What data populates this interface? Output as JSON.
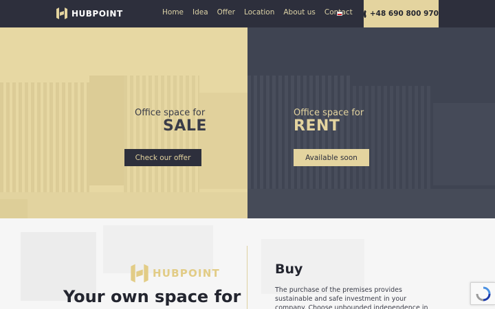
{
  "nav": {
    "brand": "HUBPOINT",
    "items": [
      {
        "label": "Home"
      },
      {
        "label": "Idea"
      },
      {
        "label": "Offer"
      },
      {
        "label": "Location"
      },
      {
        "label": "About us"
      },
      {
        "label": "Contact"
      }
    ],
    "language_icon": "poland-flag-icon",
    "phone": "+48 690 800 970",
    "phone_icon": "phone-icon"
  },
  "hero": {
    "sale": {
      "subtitle": "Office space for",
      "title": "SALE",
      "button": "Check our offer"
    },
    "rent": {
      "subtitle": "Office space for",
      "title": "RENT",
      "button": "Available soon"
    }
  },
  "intro": {
    "brand": "HUBPOINT",
    "heading": "Your own space for",
    "buy_title": "Buy",
    "buy_text": "The purchase of the premises provides sustainable and safe investment in your company. Choose unbounded independence in the prestige office"
  },
  "colors": {
    "dark": "#2d2f3c",
    "gold": "#e4d49f",
    "hero_left": "#e7d8a3",
    "hero_right": "#3f4452"
  },
  "recaptcha_icon": "recaptcha-icon"
}
